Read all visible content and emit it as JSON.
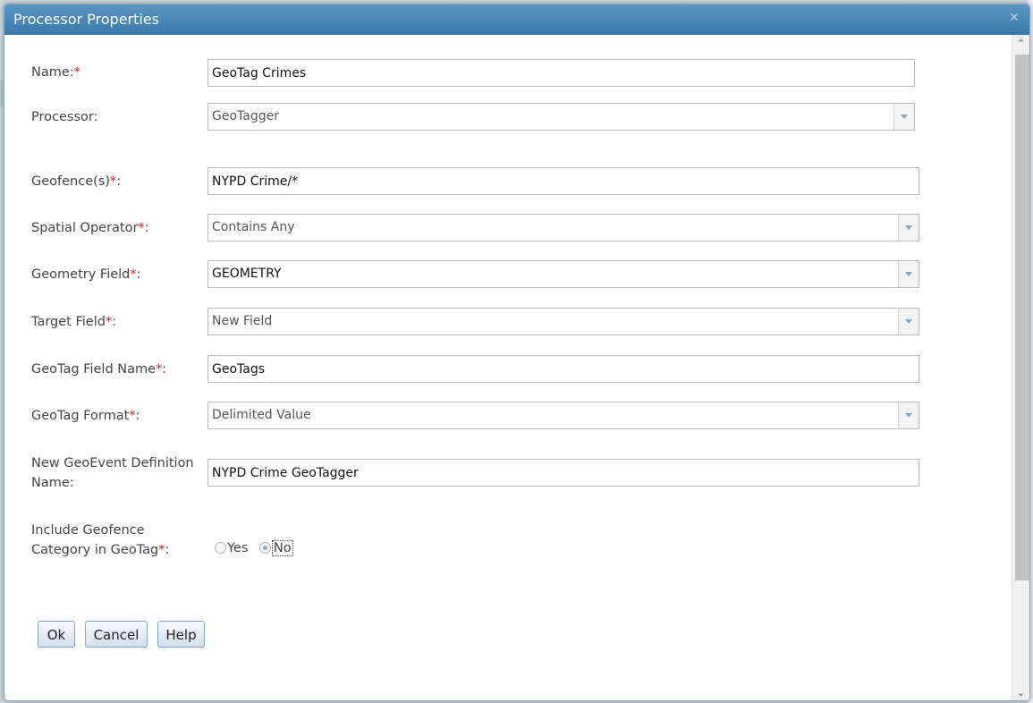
{
  "dialog": {
    "title": "Processor Properties",
    "close_icon": "✕"
  },
  "form": {
    "name": {
      "label": "Name:",
      "required_mark": "*",
      "value": "GeoTag Crimes"
    },
    "processor": {
      "label": "Processor:",
      "value": "GeoTagger"
    },
    "geofences": {
      "label": "Geofence(s)",
      "required_mark": "*",
      "suffix": ":",
      "value": "NYPD Crime/*"
    },
    "spatial_operator": {
      "label": "Spatial Operator",
      "required_mark": "*",
      "suffix": ":",
      "value": "Contains Any"
    },
    "geometry_field": {
      "label": "Geometry Field",
      "required_mark": "*",
      "suffix": ":",
      "value": "GEOMETRY"
    },
    "target_field": {
      "label": "Target Field",
      "required_mark": "*",
      "suffix": ":",
      "value": "New Field"
    },
    "geotag_field_name": {
      "label": "GeoTag Field Name",
      "required_mark": "*",
      "suffix": ":",
      "value": "GeoTags"
    },
    "geotag_format": {
      "label": "GeoTag Format",
      "required_mark": "*",
      "suffix": ":",
      "value": "Delimited Value"
    },
    "new_geoevent_definition": {
      "label_line1": "New GeoEvent Definition",
      "label_line2": "Name:",
      "value": "NYPD Crime GeoTagger"
    },
    "include_category": {
      "label_line1": "Include Geofence",
      "label_line2": "Category in GeoTag",
      "required_mark": "*",
      "suffix": ":",
      "options": [
        "Yes",
        "No"
      ],
      "selected": "No"
    }
  },
  "buttons": {
    "ok": "Ok",
    "cancel": "Cancel",
    "help": "Help"
  },
  "scrollbar": {
    "up_icon": "⌃",
    "down_icon": "⌄"
  },
  "colors": {
    "title_bar": "#3a78a8",
    "required": "#e02020",
    "button_border": "#7fa3c4"
  }
}
